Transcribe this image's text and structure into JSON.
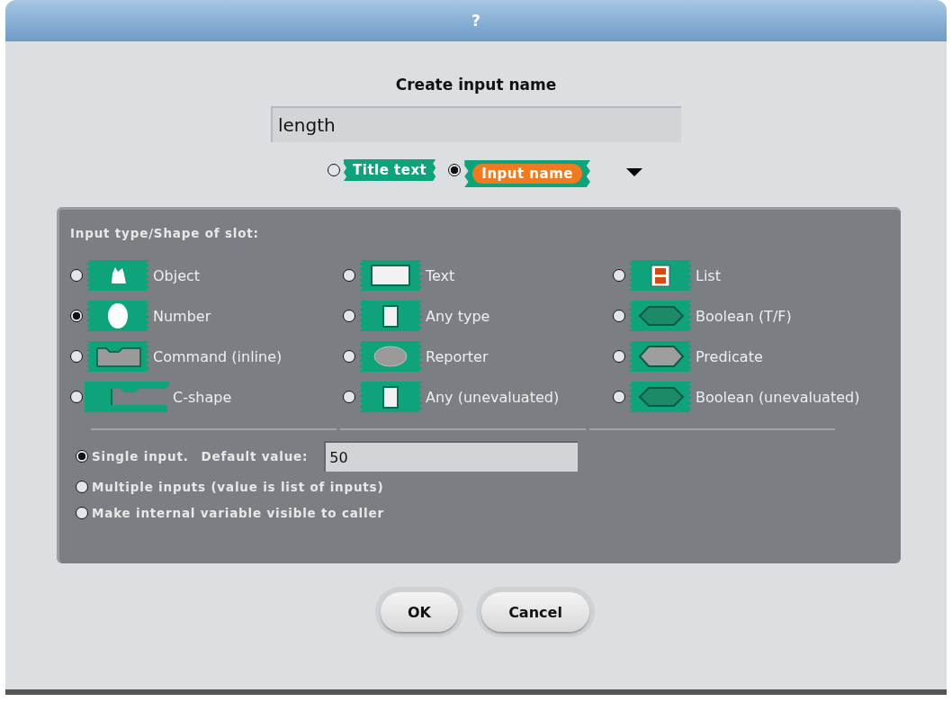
{
  "window": {
    "title": "?"
  },
  "heading": "Create input name",
  "name_field": {
    "value": "length"
  },
  "name_kind": [
    {
      "label": "Title text",
      "kind": "title",
      "selected": false
    },
    {
      "label": "Input name",
      "kind": "input",
      "selected": true
    }
  ],
  "slot_panel": {
    "title": "Input type/Shape of slot:",
    "types": [
      {
        "label": "Object",
        "kind": "object",
        "selected": false
      },
      {
        "label": "Text",
        "kind": "text",
        "selected": false
      },
      {
        "label": "List",
        "kind": "list",
        "selected": false
      },
      {
        "label": "Number",
        "kind": "number",
        "selected": true
      },
      {
        "label": "Any type",
        "kind": "any",
        "selected": false
      },
      {
        "label": "Boolean (T/F)",
        "kind": "boolean",
        "selected": false
      },
      {
        "label": "Command (inline)",
        "kind": "command",
        "selected": false
      },
      {
        "label": "Reporter",
        "kind": "reporter",
        "selected": false
      },
      {
        "label": "Predicate",
        "kind": "predicate",
        "selected": false
      },
      {
        "label": "C-shape",
        "kind": "cshape",
        "selected": false
      },
      {
        "label": "Any (unevaluated)",
        "kind": "any",
        "selected": false
      },
      {
        "label": "Boolean (unevaluated)",
        "kind": "boolean",
        "selected": false
      }
    ]
  },
  "input_modes": [
    {
      "label": "Single input.",
      "kind": "single",
      "field_label": "Default value:",
      "field_value": "50",
      "selected": true
    },
    {
      "label": "Multiple inputs (value is list of inputs)",
      "kind": "plain",
      "selected": false
    },
    {
      "label": "Make internal variable visible to caller",
      "kind": "plain",
      "selected": false
    }
  ],
  "buttons": [
    "OK",
    "Cancel"
  ]
}
